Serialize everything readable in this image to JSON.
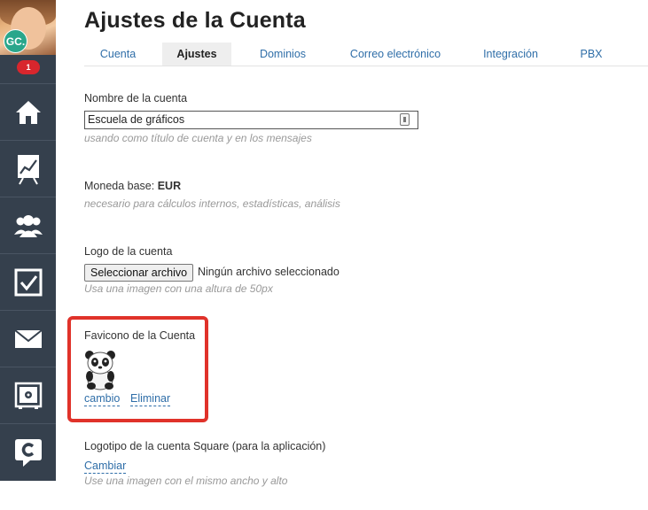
{
  "sidebar": {
    "avatar_initials": "GC.",
    "notification_count": "1",
    "items": [
      {
        "name": "home",
        "icon": "home-icon"
      },
      {
        "name": "reports",
        "icon": "chart-icon"
      },
      {
        "name": "contacts",
        "icon": "users-icon"
      },
      {
        "name": "tasks",
        "icon": "checkbox-icon"
      },
      {
        "name": "mail",
        "icon": "mail-icon"
      },
      {
        "name": "safe",
        "icon": "safe-icon"
      },
      {
        "name": "chat",
        "icon": "chat-logo-icon"
      }
    ]
  },
  "header": {
    "title": "Ajustes de la Cuenta"
  },
  "tabs": [
    {
      "label": "Cuenta",
      "active": false
    },
    {
      "label": "Ajustes",
      "active": true
    },
    {
      "label": "Dominios",
      "active": false
    },
    {
      "label": "Correo electrónico",
      "active": false
    },
    {
      "label": "Integración",
      "active": false
    },
    {
      "label": "PBX",
      "active": false
    }
  ],
  "form": {
    "account_name": {
      "label": "Nombre de la cuenta",
      "value": "Escuela de gráficos",
      "hint": "usando como título de cuenta y en los mensajes"
    },
    "currency": {
      "label": "Moneda base: ",
      "value": "EUR",
      "hint": "necesario para cálculos internos, estadísticas, análisis"
    },
    "logo": {
      "label": "Logo de la cuenta",
      "button": "Seleccionar archivo",
      "status": "Ningún archivo seleccionado",
      "hint": "Usa una imagen con una altura de 50px"
    },
    "favicon": {
      "label": "Favicono de la Cuenta",
      "change_link": "cambio",
      "remove_link": "Eliminar"
    },
    "square_logo": {
      "label": "Logotipo de la cuenta Square (para la aplicación)",
      "change_link": "Cambiar",
      "hint": "Use una imagen con el mismo ancho y alto"
    }
  },
  "colors": {
    "sidebar": "#35404d",
    "link": "#2f6ea8",
    "highlight": "#e0322a",
    "badge": "#d8262d",
    "avatar_badge": "#2aa68b"
  }
}
